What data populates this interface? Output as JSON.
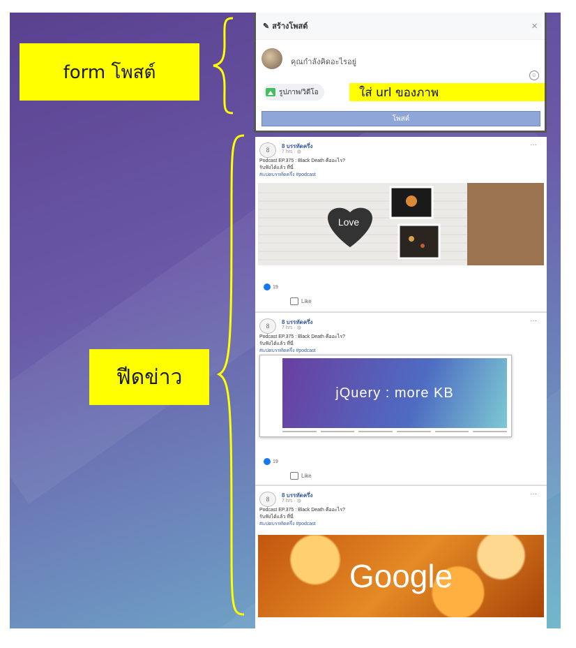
{
  "annotations": {
    "form_label": "form โพสต์",
    "feed_label": "ฟีดข่าว",
    "url_hint": "ใส่ url ของภาพ"
  },
  "form": {
    "title": "สร้างโพสต์",
    "close": "×",
    "placeholder": "คุณกำลังคิดอะไรอยู่",
    "photo_button": "รูปภาพ/วิดีโอ",
    "post_button": "โพสต์"
  },
  "posts": [
    {
      "avatar": "8",
      "author": "8 บรรทัดครึ่ง",
      "time": "7 hrs · ◍",
      "more": "···",
      "text": "Podcast EP.375 : Black Death คืออะไร?",
      "subtext": "รับฟังได้แล้ว ที่นี่",
      "tags": "#แปดบรรทัดครึ่ง #podcast",
      "image_text": "Love",
      "likes": "19",
      "like_label": "Like"
    },
    {
      "avatar": "8",
      "author": "8 บรรทัดครึ่ง",
      "time": "7 hrs · ◍",
      "more": "···",
      "text": "Podcast EP.375 : Black Death คืออะไร?",
      "subtext": "รับฟังได้แล้ว ที่นี่",
      "tags": "#แปดบรรทัดครึ่ง #podcast",
      "image_text": "jQuery : more KB",
      "likes": "19",
      "like_label": "Like"
    },
    {
      "avatar": "8",
      "author": "8 บรรทัดครึ่ง",
      "time": "7 hrs · ◍",
      "more": "···",
      "text": "Podcast EP.375 : Black Death คืออะไร?",
      "subtext": "รับฟังได้แล้ว ที่นี่",
      "tags": "#แปดบรรทัดครึ่ง #podcast",
      "image_text": "Google"
    }
  ],
  "colors": {
    "highlight": "#ffff00",
    "link": "#385898",
    "post_button": "#8fa7d8"
  },
  "icons": [
    "pencil-icon",
    "close-icon",
    "emoji-icon",
    "photo-icon",
    "like-icon",
    "thumb-icon",
    "more-icon"
  ]
}
